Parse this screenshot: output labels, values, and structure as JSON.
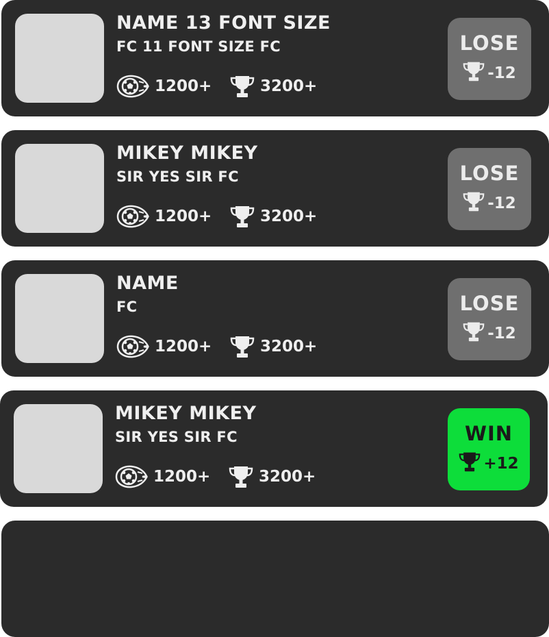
{
  "matches": [
    {
      "name": "NAME 13 FONT SIZE",
      "club": "FC 11 FONT SIZE FC",
      "rating": "1200+",
      "trophies": "3200+",
      "result": "LOSE",
      "trophy_delta": "-12"
    },
    {
      "name": "MIKEY MIKEY",
      "club": "SIR YES SIR FC",
      "rating": "1200+",
      "trophies": "3200+",
      "result": "LOSE",
      "trophy_delta": "-12"
    },
    {
      "name": "NAME",
      "club": "FC",
      "rating": "1200+",
      "trophies": "3200+",
      "result": "LOSE",
      "trophy_delta": "-12"
    },
    {
      "name": "MIKEY MIKEY",
      "club": "SIR YES SIR FC",
      "rating": "1200+",
      "trophies": "3200+",
      "result": "WIN",
      "trophy_delta": "+12"
    }
  ],
  "icons": {
    "rating": "soccer-ball-icon",
    "trophies": "trophy-icon"
  },
  "colors": {
    "card_background": "#2b2b2b",
    "avatar_placeholder": "#d9d9d9",
    "lose_badge": "#6f6f6f",
    "win_badge": "#0ddd3a",
    "text": "#efefef"
  }
}
